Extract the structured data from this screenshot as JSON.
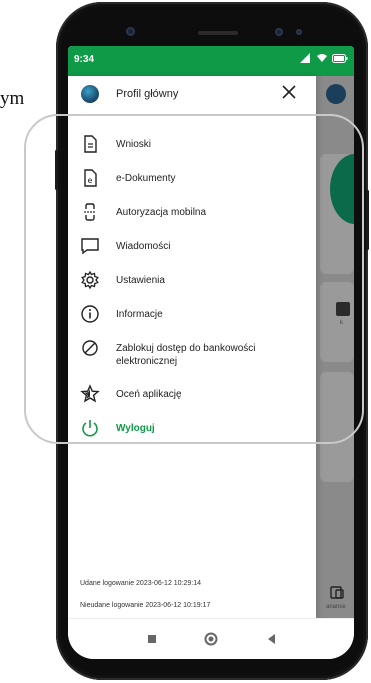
{
  "page_fragment": "ym",
  "status_bar": {
    "time": "9:34"
  },
  "drawer": {
    "profile_title": "Profil główny",
    "menu": [
      {
        "label": "Wnioski",
        "icon": "document-icon"
      },
      {
        "label": "e-Dokumenty",
        "icon": "e-document-icon"
      },
      {
        "label": "Autoryzacja mobilna",
        "icon": "mobile-auth-icon"
      },
      {
        "label": "Wiadomości",
        "icon": "message-icon"
      },
      {
        "label": "Ustawienia",
        "icon": "gear-icon"
      },
      {
        "label": "Informacje",
        "icon": "info-icon"
      },
      {
        "label": "Zablokuj dostęp do bankowości elektronicznej",
        "icon": "block-icon"
      },
      {
        "label": "Oceń aplikację",
        "icon": "star-icon"
      },
      {
        "label": "Wyloguj",
        "icon": "power-icon"
      }
    ],
    "login_success": "Udane logowanie 2023-06-12 10:29:14",
    "login_failed": "Nieudane logowanie 2023-06-12 10:19:17"
  },
  "backdrop": {
    "partial_label": "k",
    "partial_tab": "ananse"
  },
  "colors": {
    "accent": "#0f9a48",
    "backdrop": "#8a8a8a"
  }
}
